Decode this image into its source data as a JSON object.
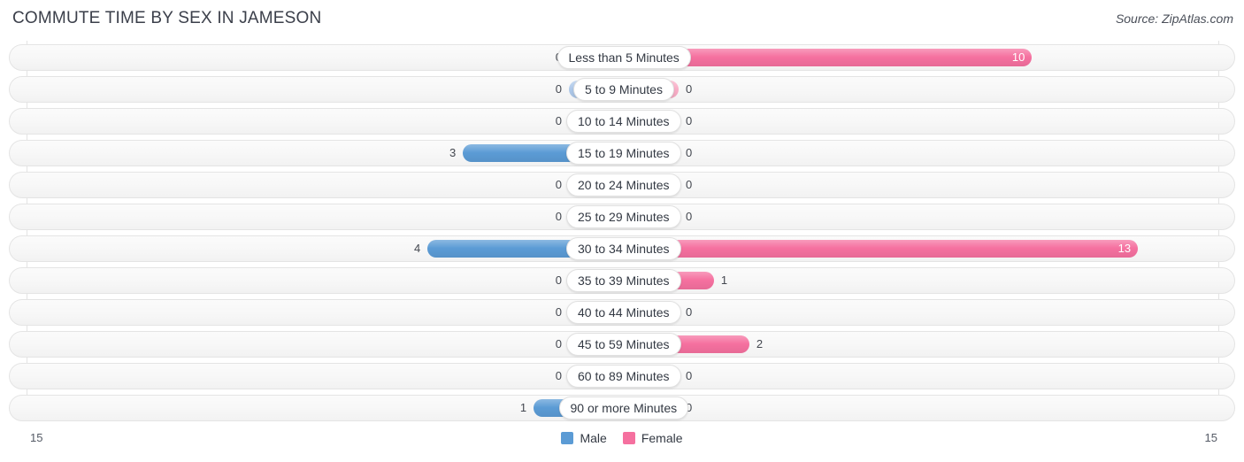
{
  "header": {
    "title": "COMMUTE TIME BY SEX IN JAMESON",
    "source": "Source: ZipAtlas.com"
  },
  "axis": {
    "left_label": "15",
    "right_label": "15"
  },
  "legend": {
    "male_label": "Male",
    "female_label": "Female"
  },
  "colors": {
    "male": "#5b9bd5",
    "male_muted": "#aec9ea",
    "female": "#f5709f",
    "female_muted": "#f9aec7",
    "title": "#3b3f4a",
    "row_bg": "#f7f7f7",
    "row_border": "#e4e4e4",
    "gridline": "#e3e3e3"
  },
  "chart_data": {
    "type": "bar",
    "orientation": "horizontal-diverging",
    "title": "COMMUTE TIME BY SEX IN JAMESON",
    "xlabel": "",
    "ylabel": "",
    "xlim": [
      15,
      15
    ],
    "grid": true,
    "legend_position": "bottom-center",
    "categories": [
      "Less than 5 Minutes",
      "5 to 9 Minutes",
      "10 to 14 Minutes",
      "15 to 19 Minutes",
      "20 to 24 Minutes",
      "25 to 29 Minutes",
      "30 to 34 Minutes",
      "35 to 39 Minutes",
      "40 to 44 Minutes",
      "45 to 59 Minutes",
      "60 to 89 Minutes",
      "90 or more Minutes"
    ],
    "series": [
      {
        "name": "Male",
        "side": "left",
        "color": "#5b9bd5",
        "values": [
          0,
          0,
          0,
          3,
          0,
          0,
          4,
          0,
          0,
          0,
          0,
          1
        ],
        "labels": [
          "0",
          "0",
          "0",
          "3",
          "0",
          "0",
          "4",
          "0",
          "0",
          "0",
          "0",
          "1"
        ]
      },
      {
        "name": "Female",
        "side": "right",
        "color": "#f5709f",
        "values": [
          10,
          0,
          0,
          0,
          0,
          0,
          13,
          1,
          0,
          2,
          0,
          0
        ],
        "labels": [
          "10",
          "0",
          "0",
          "0",
          "0",
          "0",
          "13",
          "1",
          "0",
          "2",
          "0",
          "0"
        ]
      }
    ]
  }
}
